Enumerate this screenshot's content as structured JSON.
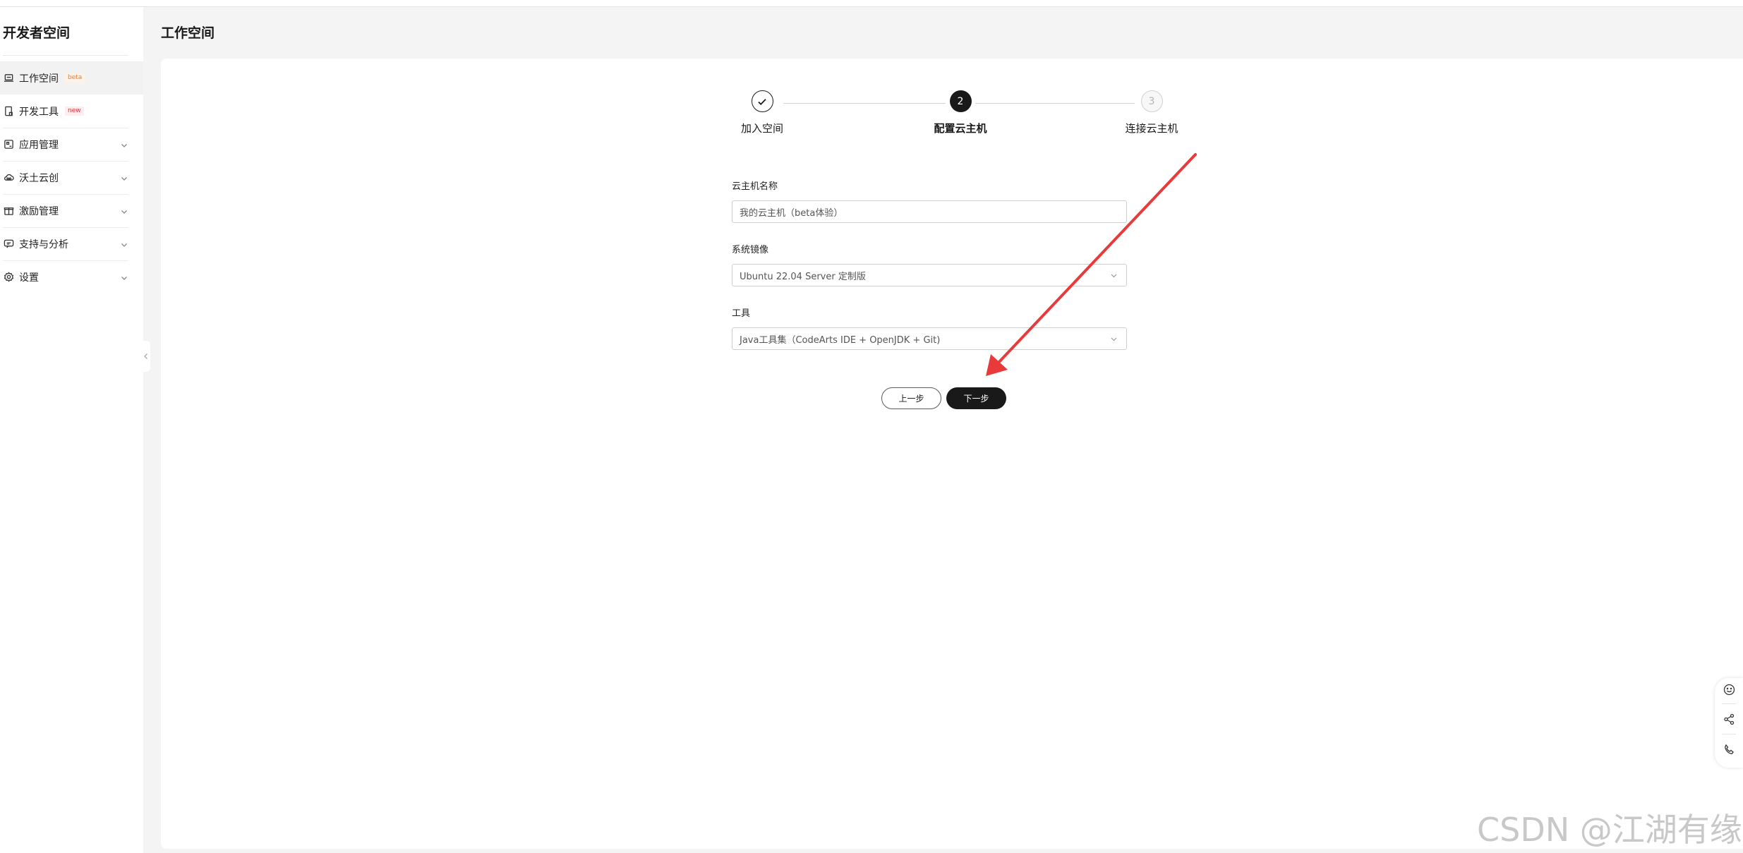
{
  "sidebar": {
    "brand": "开发者空间",
    "items": [
      {
        "label": "工作空间",
        "tag": "beta"
      },
      {
        "label": "开发工具",
        "tag": "new"
      },
      {
        "label": "应用管理"
      },
      {
        "label": "沃土云创"
      },
      {
        "label": "激励管理"
      },
      {
        "label": "支持与分析"
      },
      {
        "label": "设置"
      }
    ]
  },
  "header": {
    "title": "工作空间"
  },
  "steps": [
    {
      "number": "1",
      "label": "加入空间",
      "status": "done"
    },
    {
      "number": "2",
      "label": "配置云主机",
      "status": "current"
    },
    {
      "number": "3",
      "label": "连接云主机",
      "status": "pending"
    }
  ],
  "form": {
    "name": {
      "label": "云主机名称",
      "value": "我的云主机（beta体验）"
    },
    "image": {
      "label": "系统镜像",
      "value": "Ubuntu 22.04 Server 定制版"
    },
    "tools": {
      "label": "工具",
      "value": "Java工具集（CodeArts IDE + OpenJDK + Git)"
    }
  },
  "buttons": {
    "prev": "上一步",
    "next": "下一步"
  },
  "watermark": "CSDN @江湖有缘",
  "colors": {
    "primary": "#191919",
    "annotation_arrow": "#e83a3a",
    "beta_tag": "#e8823a",
    "new_tag": "#e0323a"
  }
}
